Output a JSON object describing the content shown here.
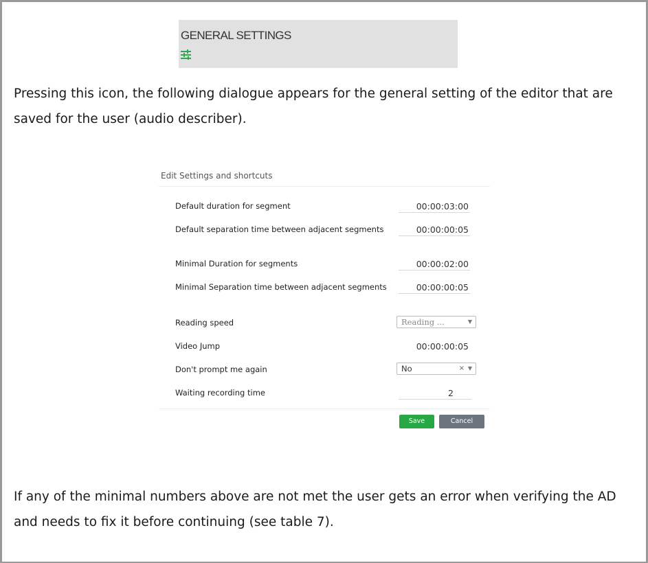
{
  "banner": {
    "title": "GENERAL SETTINGS",
    "icon": "sliders-icon",
    "icon_color": "#2fa84f"
  },
  "paragraph1": "Pressing this icon, the following dialogue appears for the general setting of the editor that are saved for the user (audio describer).",
  "dialog": {
    "title": "Edit Settings and shortcuts",
    "rows": [
      {
        "label": "Default duration for segment",
        "value": "00:00:03:00"
      },
      {
        "label": "Default separation time between adjacent segments",
        "value": "00:00:00:05"
      },
      {
        "label": "Minimal Duration for segments",
        "value": "00:00:02:00"
      },
      {
        "label": "Minimal Separation time between adjacent segments",
        "value": "00:00:00:05"
      },
      {
        "label": "Reading speed",
        "select_value": "Reading ...",
        "caret": "▼"
      },
      {
        "label": "Video Jump",
        "value": "00:00:00:05"
      },
      {
        "label": "Don't prompt me again",
        "select_value": "No",
        "clear": "×",
        "caret": "▼"
      },
      {
        "label": "Waiting recording time",
        "value": "2"
      }
    ],
    "save_label": "Save",
    "cancel_label": "Cancel",
    "save_color": "#28a745",
    "cancel_color": "#6c757d"
  },
  "paragraph2": "If any of the minimal numbers above are not met the user gets an error when verifying the AD and needs to fix it before continuing (see table 7)."
}
